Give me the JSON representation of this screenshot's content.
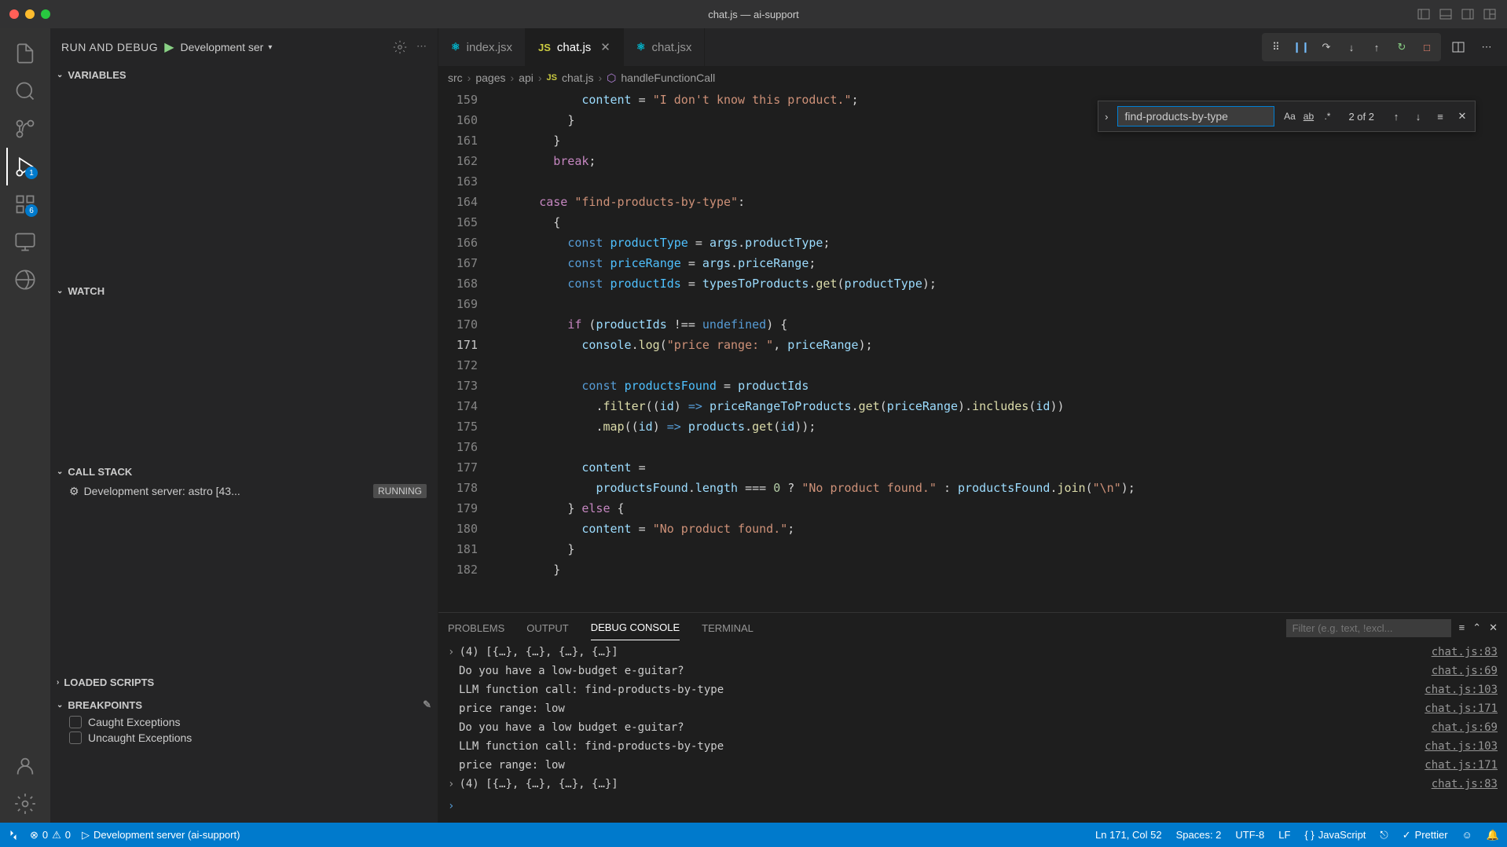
{
  "window": {
    "title": "chat.js — ai-support"
  },
  "activitybar": {
    "debug_badge": "1",
    "ext_badge": "6"
  },
  "sidebar": {
    "header": "RUN AND DEBUG",
    "config": "Development ser",
    "sections": {
      "variables": "VARIABLES",
      "watch": "WATCH",
      "callstack": "CALL STACK",
      "loaded": "LOADED SCRIPTS",
      "breakpoints": "BREAKPOINTS"
    },
    "callstack_item": "Development server: astro [43...",
    "callstack_status": "RUNNING",
    "bp_caught": "Caught Exceptions",
    "bp_uncaught": "Uncaught Exceptions"
  },
  "tabs": {
    "t0": {
      "label": "index.jsx"
    },
    "t1": {
      "label": "chat.js"
    },
    "t2": {
      "label": "chat.jsx"
    }
  },
  "breadcrumbs": {
    "p0": "src",
    "p1": "pages",
    "p2": "api",
    "p3": "chat.js",
    "p4": "handleFunctionCall"
  },
  "search": {
    "value": "find-products-by-type",
    "count": "2 of 2"
  },
  "code": {
    "lines": {
      "159": {
        "num": "159"
      },
      "160": {
        "num": "160"
      },
      "161": {
        "num": "161"
      },
      "162": {
        "num": "162"
      },
      "163": {
        "num": "163"
      },
      "164": {
        "num": "164"
      },
      "165": {
        "num": "165"
      },
      "166": {
        "num": "166"
      },
      "167": {
        "num": "167"
      },
      "168": {
        "num": "168"
      },
      "169": {
        "num": "169"
      },
      "170": {
        "num": "170"
      },
      "171": {
        "num": "171"
      },
      "172": {
        "num": "172"
      },
      "173": {
        "num": "173"
      },
      "174": {
        "num": "174"
      },
      "175": {
        "num": "175"
      },
      "176": {
        "num": "176"
      },
      "177": {
        "num": "177"
      },
      "178": {
        "num": "178"
      },
      "179": {
        "num": "179"
      },
      "180": {
        "num": "180"
      },
      "181": {
        "num": "181"
      },
      "182": {
        "num": "182"
      }
    },
    "tokens": {
      "content": "content",
      "eq": " = ",
      "dontknow": "\"I don't know this product.\"",
      "semi": ";",
      "rbrace": "}",
      "break": "break",
      "case": "case",
      "caseval": "\"find-products-by-type\"",
      "colon": ":",
      "lbrace": "{",
      "const": "const",
      "productType": "productType",
      "args": "args",
      "dot": ".",
      "priceRange": "priceRange",
      "productIds": "productIds",
      "typesToProducts": "typesToProducts",
      "get": "get",
      "lp": "(",
      "rp": ")",
      "if": "if",
      "neq": " !== ",
      "undefined": "undefined",
      "console": "console",
      "log": "log",
      "logstr": "\"price range: \"",
      "comma": ", ",
      "productsFound": "productsFound",
      "filter": "filter",
      "id": "id",
      "arrow": " => ",
      "priceRangeToProducts": "priceRangeToProducts",
      "includes": "includes",
      "map": "map",
      "products": "products",
      "length": "length",
      "teq": " === ",
      "zero": "0",
      "q": " ? ",
      "noprod": "\"No product found.\"",
      "tcolon": " : ",
      "join": "join",
      "nl": "\"\\n\"",
      "else": "else",
      "sp": " "
    }
  },
  "panel": {
    "tabs": {
      "problems": "PROBLEMS",
      "output": "OUTPUT",
      "debug": "DEBUG CONSOLE",
      "terminal": "TERMINAL"
    },
    "filter_placeholder": "Filter (e.g. text, !excl...",
    "lines": {
      "l0": {
        "text": "(4) [{…}, {…}, {…}, {…}]",
        "src": "chat.js:83"
      },
      "l1": {
        "text": "Do you have a low-budget e-guitar?",
        "src": "chat.js:69"
      },
      "l2": {
        "text": "LLM function call:  find-products-by-type",
        "src": "chat.js:103"
      },
      "l3": {
        "text": "price range:  low",
        "src": "chat.js:171"
      },
      "l4": {
        "text": "Do you have a low budget e-guitar?",
        "src": "chat.js:69"
      },
      "l5": {
        "text": "LLM function call:  find-products-by-type",
        "src": "chat.js:103"
      },
      "l6": {
        "text": "price range:  low",
        "src": "chat.js:171"
      },
      "l7": {
        "text": "(4) [{…}, {…}, {…}, {…}]",
        "src": "chat.js:83"
      }
    }
  },
  "statusbar": {
    "errors": "0",
    "warnings": "0",
    "server": "Development server (ai-support)",
    "cursor": "Ln 171, Col 52",
    "spaces": "Spaces: 2",
    "encoding": "UTF-8",
    "eol": "LF",
    "lang": "JavaScript",
    "prettier": "Prettier"
  }
}
